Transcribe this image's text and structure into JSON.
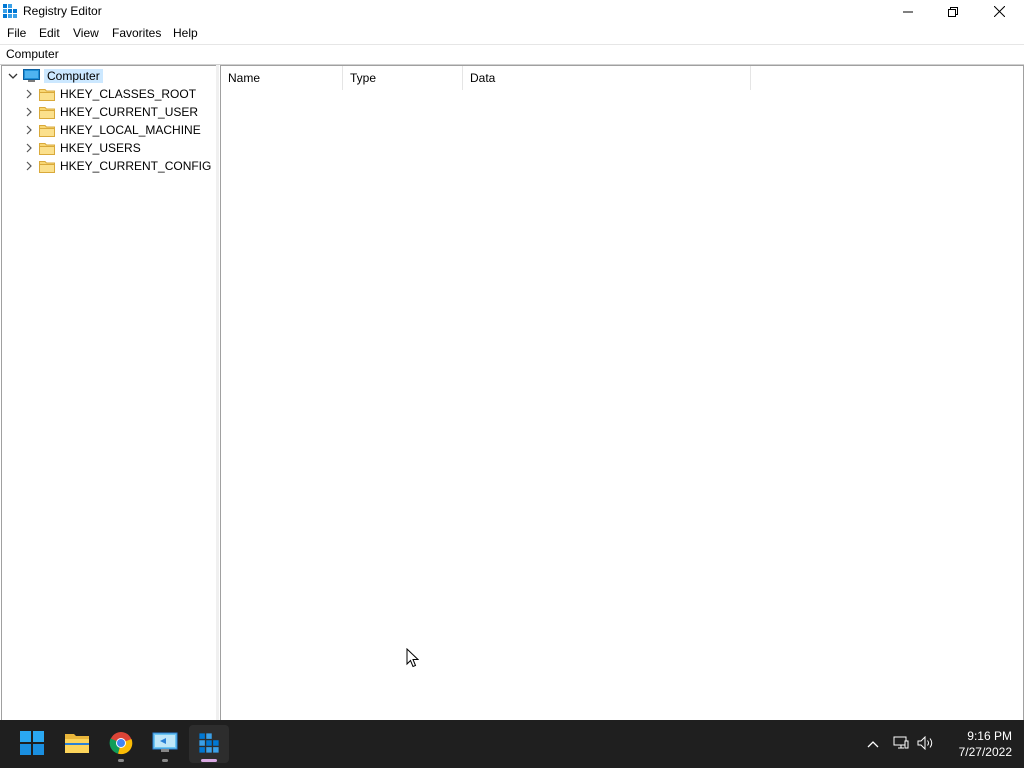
{
  "window": {
    "title": "Registry Editor",
    "icon": "regedit-icon"
  },
  "menu": {
    "file": "File",
    "edit": "Edit",
    "view": "View",
    "favorites": "Favorites",
    "help": "Help"
  },
  "address": "Computer",
  "tree": {
    "root": "Computer",
    "items": [
      {
        "label": "HKEY_CLASSES_ROOT"
      },
      {
        "label": "HKEY_CURRENT_USER"
      },
      {
        "label": "HKEY_LOCAL_MACHINE"
      },
      {
        "label": "HKEY_USERS"
      },
      {
        "label": "HKEY_CURRENT_CONFIG"
      }
    ]
  },
  "list": {
    "columns": {
      "name": "Name",
      "type": "Type",
      "data": "Data"
    }
  },
  "taskbar": {
    "apps": [
      "start-icon",
      "file-explorer-icon",
      "chrome-icon",
      "remote-desktop-icon",
      "regedit-icon"
    ],
    "time": "9:16 PM",
    "date": "7/27/2022"
  },
  "colors": {
    "selection": "#cce8ff",
    "taskbar": "#1f1f1f",
    "folder": "#f8d775",
    "accent": "#0078d4"
  }
}
